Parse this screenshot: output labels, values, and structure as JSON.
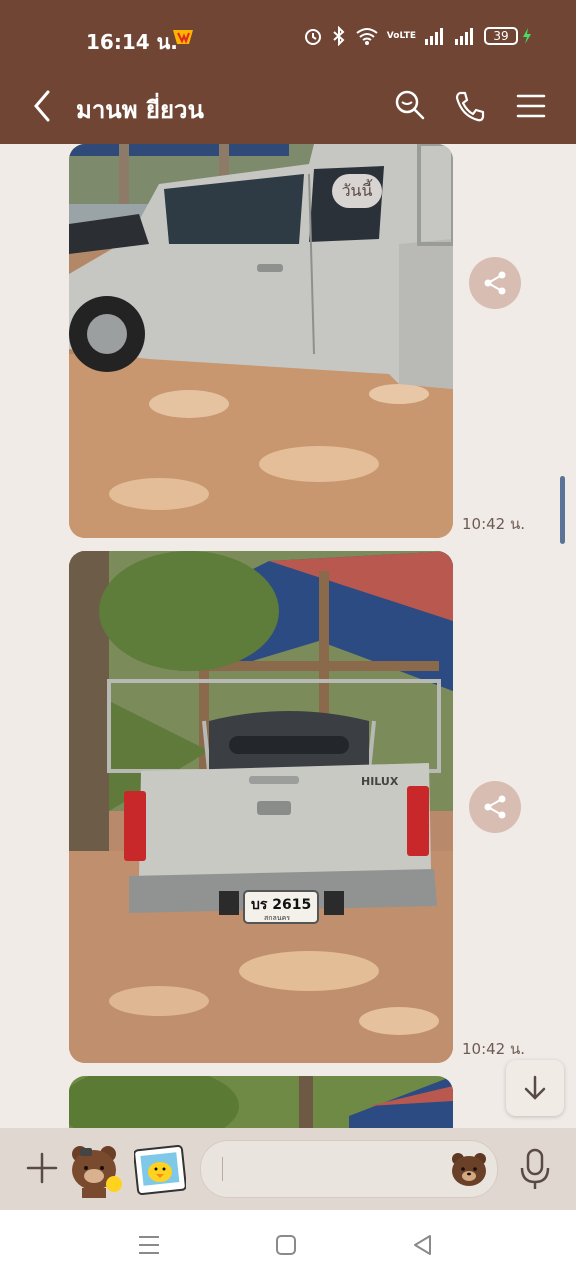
{
  "status_bar": {
    "time": "16:14 น.",
    "battery": "39",
    "network_label": "VoLTE"
  },
  "header": {
    "back_icon": "chevron-left-icon",
    "title": "มานพ  ยี่ยวน",
    "icons": [
      "search-icon",
      "phone-icon",
      "menu-icon"
    ]
  },
  "chat": {
    "date_pill": "วันนี้",
    "messages": [
      {
        "type": "image",
        "time": "10:42 น."
      },
      {
        "type": "image",
        "time": "10:42 น.",
        "plate_text": "บร 2615",
        "plate_province": "สกลนคร",
        "badge": "HILUX"
      },
      {
        "type": "image"
      }
    ]
  },
  "input_bar": {
    "placeholder": "",
    "icons": [
      "plus-icon",
      "sticker-brown-icon",
      "sticker-sally-icon",
      "emoji-icon",
      "microphone-icon"
    ]
  },
  "nav_bar": {
    "icons": [
      "recent-apps-icon",
      "home-icon",
      "back-icon"
    ]
  },
  "colors": {
    "brand": "#714534",
    "chat_bg": "#f0ebe6",
    "share_button": "#d8bdb3",
    "input_bar": "#e1d7d1"
  }
}
